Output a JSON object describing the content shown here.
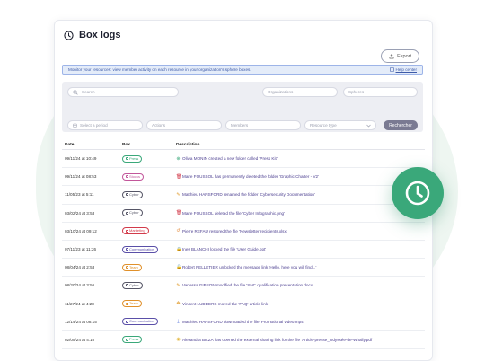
{
  "header": {
    "title": "Box logs",
    "export_label": "Export"
  },
  "info": {
    "text": "Monitor your resources: view member activity on each resource in your organization's sphere boxes.",
    "help_label": "Help center"
  },
  "filters": {
    "search_placeholder": "Search",
    "organizations_placeholder": "Organizations",
    "spheres_placeholder": "Spheres",
    "period_placeholder": "Select a period",
    "actions_placeholder": "Actions",
    "members_placeholder": "Members",
    "resource_type_placeholder": "Resource type",
    "search_button": "Rechercher"
  },
  "table": {
    "headers": {
      "date": "Date",
      "box": "Box",
      "description": "Description"
    },
    "rows": [
      {
        "date": "09/11/24 at 10:49",
        "box": "Press",
        "box_color": "#3aa87a",
        "icon": "folder-plus",
        "glyph": "⊕",
        "icon_color": "#3aa87a",
        "description": "Olivia MONIN created a new folder called 'Press Kit'"
      },
      {
        "date": "09/11/24 at 08:53",
        "box": "Stocks",
        "box_color": "#c2569a",
        "icon": "trash",
        "glyph": "🗑",
        "icon_color": "#d23a4a",
        "description": "Marie FOUSSOL has permanently deleted the folder 'Graphic Charter - V2'"
      },
      {
        "date": "11/05/23 at 5:11",
        "box": "Cyber",
        "box_color": "#555566",
        "icon": "pencil",
        "glyph": "✎",
        "icon_color": "#e09a2a",
        "description": "Matthieu HANSFORD renamed the folder 'Cybersecurity Documentation'"
      },
      {
        "date": "03/02/24 at 3:53",
        "box": "Cyber",
        "box_color": "#555566",
        "icon": "trash",
        "glyph": "🗑",
        "icon_color": "#d23a4a",
        "description": "Marie FOUSSOL deleted the file 'Cyber Infographic.png'"
      },
      {
        "date": "03/10/24 at 09:12",
        "box": "Marketing",
        "box_color": "#d23a4a",
        "icon": "restore",
        "glyph": "↺",
        "icon_color": "#e0802a",
        "description": "Pierre REFAU restored the file 'Newsletter recipients.xlsx'"
      },
      {
        "date": "07/11/23 at 11:26",
        "box": "Communication",
        "box_color": "#5a4fa8",
        "icon": "lock",
        "glyph": "🔒",
        "icon_color": "#d23a4a",
        "description": "Ines BLANCHI locked the file 'User Guide.ppt'"
      },
      {
        "date": "08/04/24 at 2:53",
        "box": "Team",
        "box_color": "#e0902a",
        "icon": "unlock",
        "glyph": "🔓",
        "icon_color": "#3aa87a",
        "description": "Robert PELLETIER unlocked the message link 'Hello, here you will find...'"
      },
      {
        "date": "08/20/24 at 3:56",
        "box": "Cyber",
        "box_color": "#555566",
        "icon": "edit-file",
        "glyph": "✎",
        "icon_color": "#e09a2a",
        "description": "Vanessa GIBSON modified the file 'SNC qualification presentation.docx'"
      },
      {
        "date": "11/27/24 at 4:28",
        "box": "Team",
        "box_color": "#e0902a",
        "icon": "move",
        "glyph": "✥",
        "icon_color": "#e09a2a",
        "description": "Vincent LUDDERS moved the 'FAQ' article link"
      },
      {
        "date": "12/14/24 at 08:15",
        "box": "Communication",
        "box_color": "#5a4fa8",
        "icon": "download",
        "glyph": "⤓",
        "icon_color": "#4a6ad8",
        "description": "Matthieu HANSFORD downloaded the file 'Promotional video.mp4'"
      },
      {
        "date": "02/05/24 at 4:10",
        "box": "Press",
        "box_color": "#3aa87a",
        "icon": "eye",
        "glyph": "◉",
        "icon_color": "#e0b02a",
        "description": "Alexandra BILZA has opened the external sharing link for the file 'Article-presse_Odyssée-de-Whally.pdf'"
      }
    ]
  },
  "colors": {
    "accent": "#3aa87a",
    "button": "#7a7a92",
    "info_bg": "#e4ecf9"
  }
}
